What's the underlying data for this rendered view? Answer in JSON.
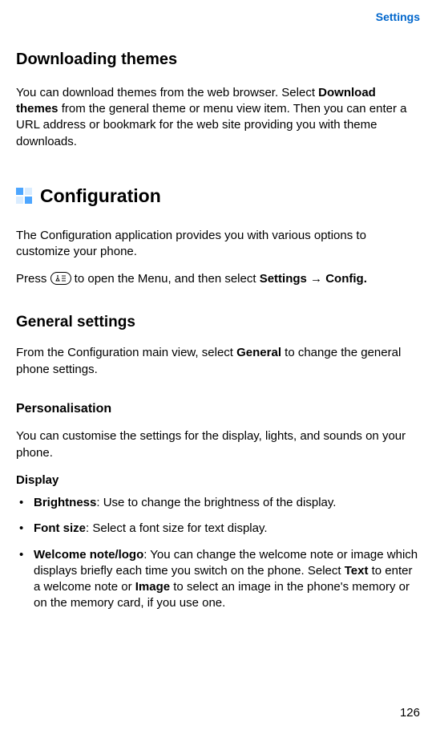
{
  "header": {
    "label": "Settings"
  },
  "section1": {
    "title": "Downloading themes",
    "para_pre": "You can download themes from the web browser. Select ",
    "para_bold1": "Download themes",
    "para_post": " from the general theme or menu view item. Then you can enter a URL address or bookmark for the web site providing you with theme downloads."
  },
  "config": {
    "title": "Configuration",
    "intro": "The Configuration application provides you with various options to customize your phone.",
    "press_pre": "Press ",
    "press_mid": " to open the Menu, and then select ",
    "press_b1": "Settings",
    "press_arrow": " → ",
    "press_b2": "Config."
  },
  "general": {
    "title": "General settings",
    "intro_pre": "From the Configuration main view, select ",
    "intro_b": "General",
    "intro_post": " to change the general phone settings."
  },
  "personalisation": {
    "title": "Personalisation",
    "intro": "You can customise the settings for the display, lights, and sounds on your phone."
  },
  "display": {
    "title": "Display",
    "items": [
      {
        "label": "Brightness",
        "text": ": Use to change the brightness of the display."
      },
      {
        "label": "Font size",
        "text": ": Select a font size for text display."
      }
    ],
    "welcome": {
      "label": "Welcome note/logo",
      "pre": ": You can change the welcome note or image which displays briefly each time you switch on the phone. Select ",
      "b1": "Text",
      "mid": " to enter a welcome note or ",
      "b2": "Image",
      "post": " to select an image in the phone's memory or on the memory card, if you use one."
    }
  },
  "page": {
    "number": "126"
  }
}
